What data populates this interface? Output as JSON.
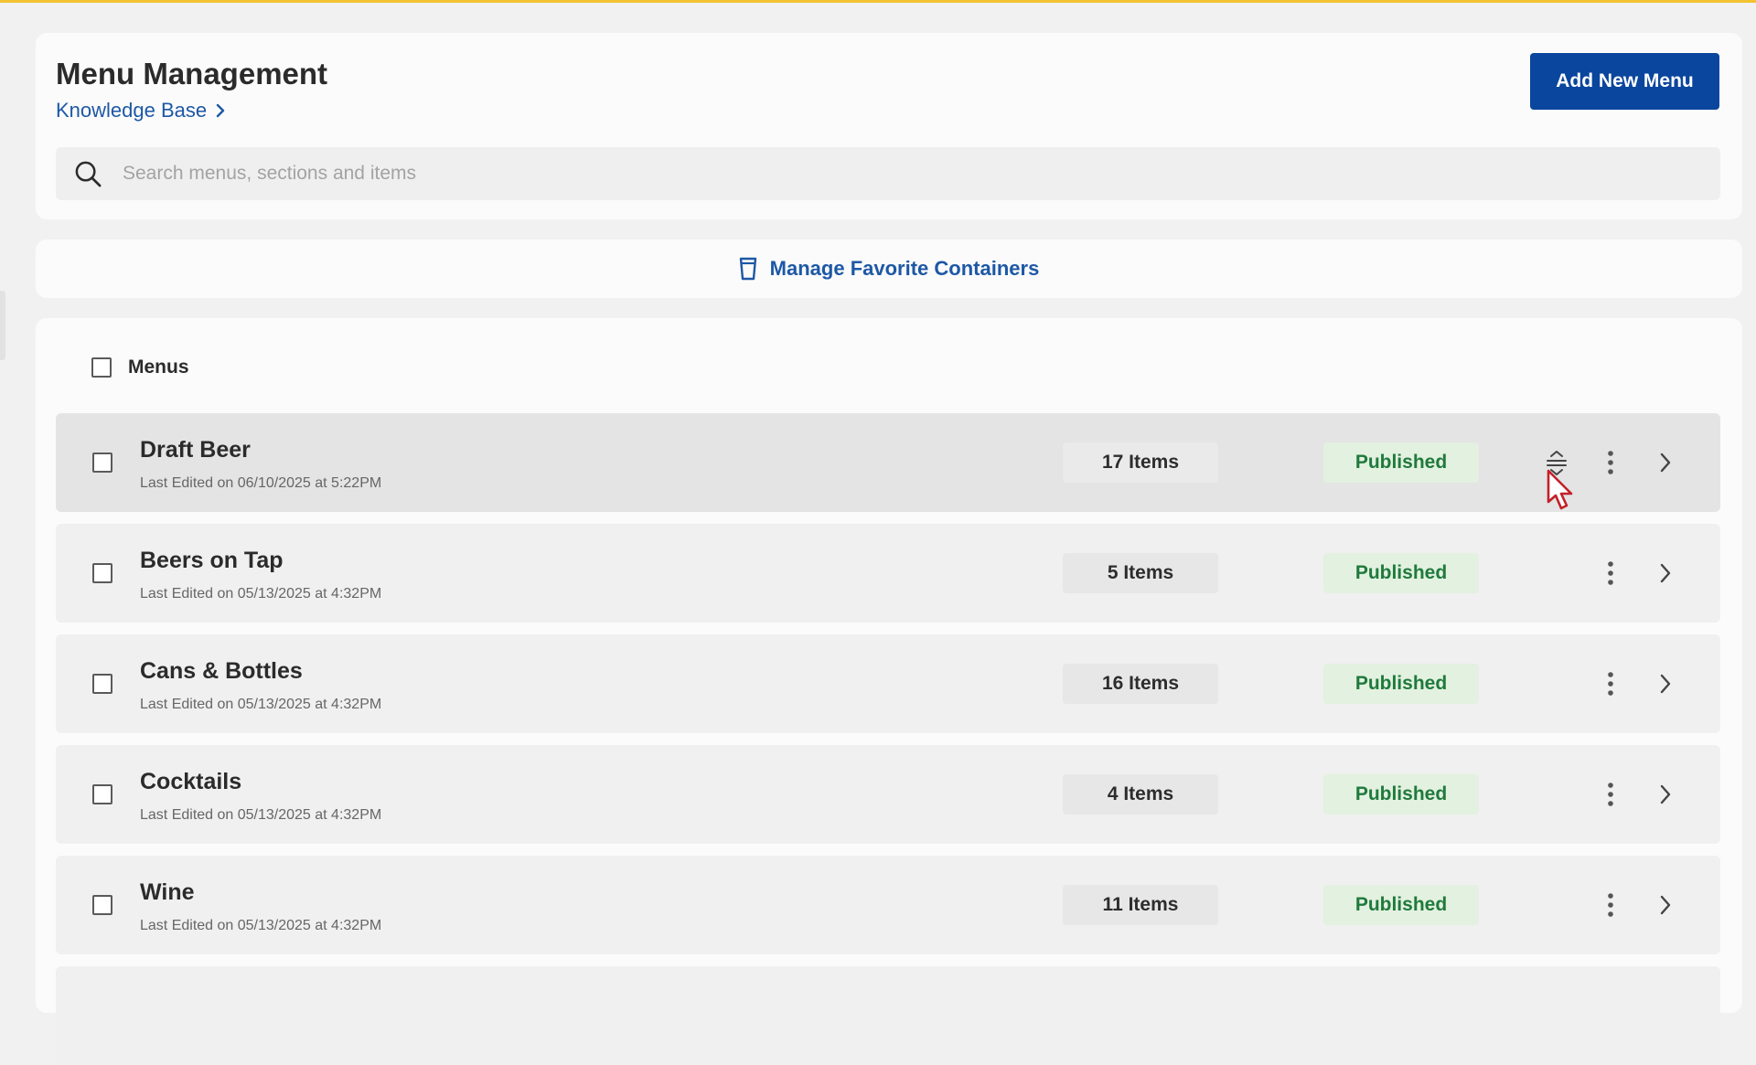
{
  "header": {
    "title": "Menu Management",
    "breadcrumb": "Knowledge Base",
    "add_button": "Add New Menu",
    "search_placeholder": "Search menus, sections and items"
  },
  "favorites": {
    "label": "Manage Favorite Containers"
  },
  "list": {
    "select_all_label": "Menus",
    "rows": [
      {
        "name": "Draft Beer",
        "edited": "Last Edited on 06/10/2025 at 5:22PM",
        "count": "17 Items",
        "status": "Published"
      },
      {
        "name": "Beers on Tap",
        "edited": "Last Edited on 05/13/2025 at 4:32PM",
        "count": "5 Items",
        "status": "Published"
      },
      {
        "name": "Cans & Bottles",
        "edited": "Last Edited on 05/13/2025 at 4:32PM",
        "count": "16 Items",
        "status": "Published"
      },
      {
        "name": "Cocktails",
        "edited": "Last Edited on 05/13/2025 at 4:32PM",
        "count": "4 Items",
        "status": "Published"
      },
      {
        "name": "Wine",
        "edited": "Last Edited on 05/13/2025 at 4:32PM",
        "count": "11 Items",
        "status": "Published"
      }
    ]
  },
  "colors": {
    "accent_bar": "#f2c230",
    "primary_blue": "#0a469d",
    "link_blue": "#1d58a5",
    "published_green": "#1f7a3c",
    "published_bg": "#e3f1e0"
  },
  "icons": [
    "search-icon",
    "chevron-right-icon",
    "cup-icon",
    "drag-handle-icon",
    "more-vertical-icon",
    "mouse-cursor-icon"
  ]
}
